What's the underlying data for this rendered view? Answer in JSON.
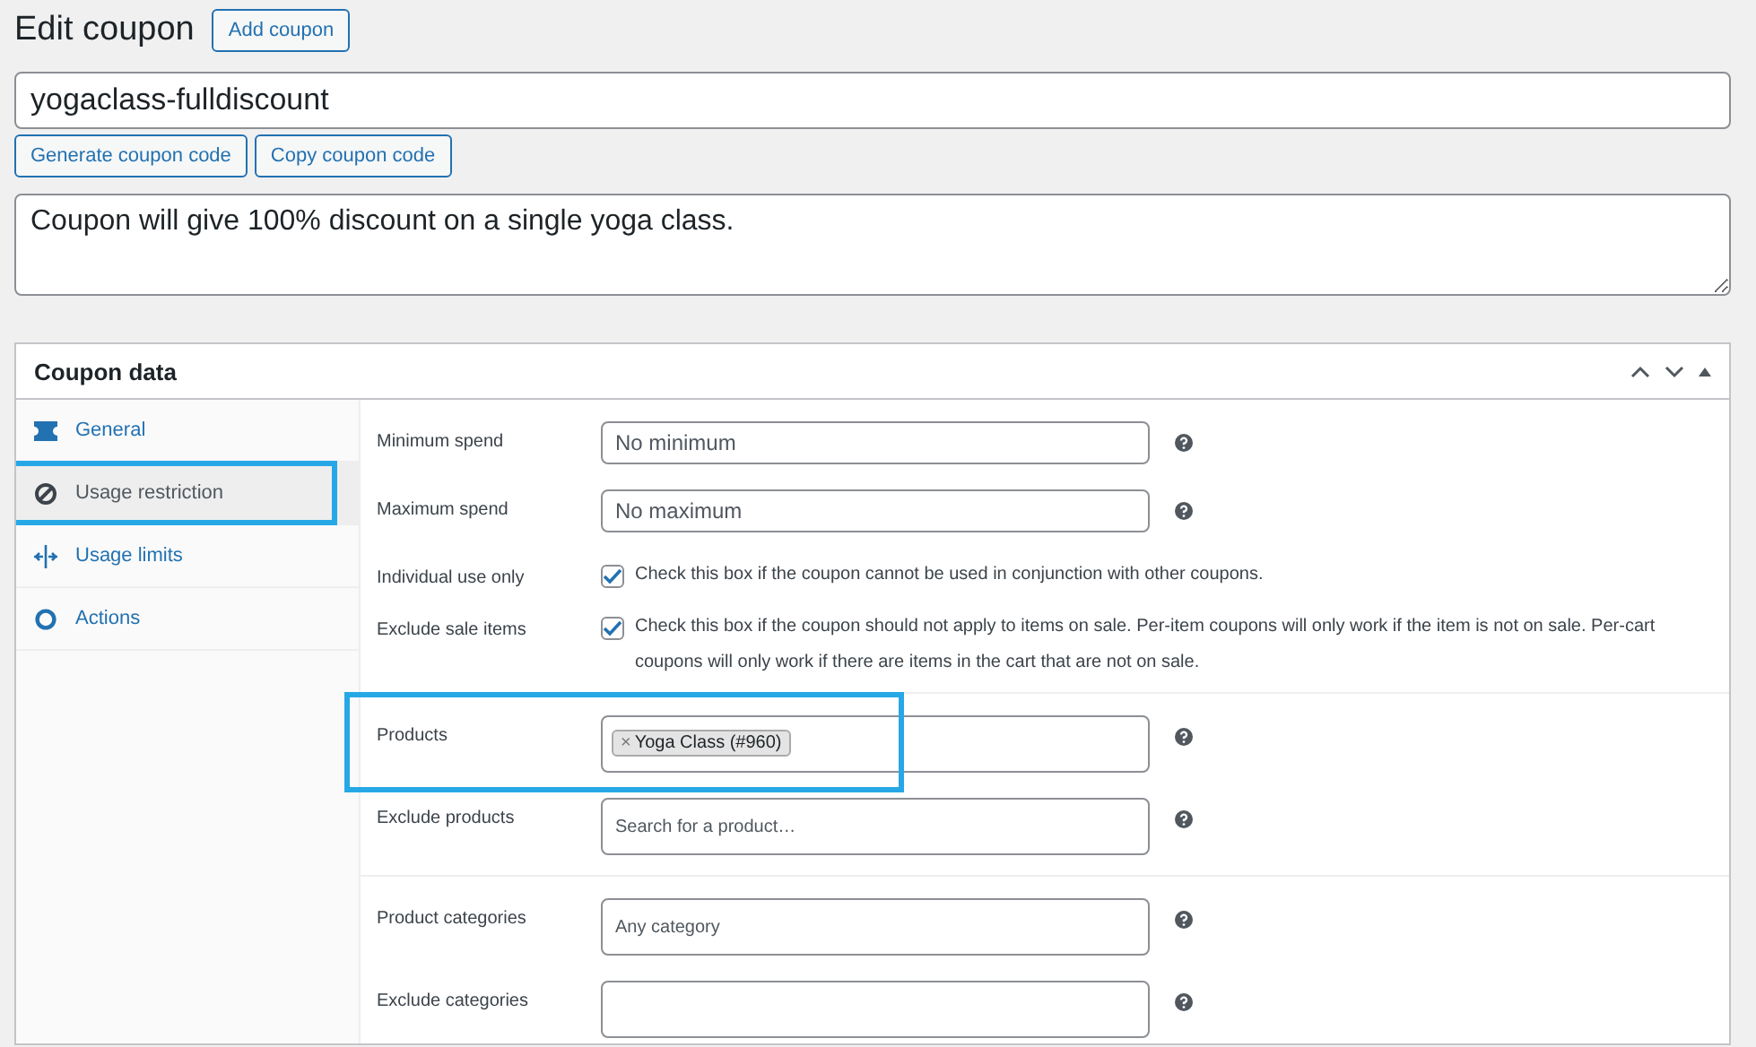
{
  "header": {
    "title": "Edit coupon",
    "add_button": "Add coupon"
  },
  "coupon_code": {
    "value": "yogaclass-fulldiscount"
  },
  "code_buttons": [
    "Generate coupon code",
    "Copy coupon code"
  ],
  "description": {
    "value": "Coupon will give 100% discount on a single yoga class."
  },
  "panel": {
    "title": "Coupon data",
    "tabs": [
      {
        "label": "General",
        "selected": false,
        "highlighted": false
      },
      {
        "label": "Usage restriction",
        "selected": true,
        "highlighted": true
      },
      {
        "label": "Usage limits",
        "selected": false,
        "highlighted": false
      },
      {
        "label": "Actions",
        "selected": false,
        "highlighted": false
      }
    ],
    "groups": [
      {
        "rows": [
          {
            "kind": "input",
            "label": "Minimum spend",
            "placeholder": "No minimum"
          },
          {
            "kind": "input",
            "label": "Maximum spend",
            "placeholder": "No maximum"
          },
          {
            "kind": "checkbox",
            "label": "Individual use only",
            "checked": true,
            "text": "Check this box if the coupon cannot be used in conjunction with other coupons."
          },
          {
            "kind": "checkbox",
            "label": "Exclude sale items",
            "checked": true,
            "text": "Check this box if the coupon should not apply to items on sale. Per-item coupons will only work if the item is not on sale. Per-cart coupons will only work if there are items in the cart that are not on sale."
          }
        ]
      },
      {
        "rows": [
          {
            "kind": "tokens",
            "label": "Products",
            "tokens": [
              {
                "remove": "×",
                "label": "Yoga Class (#960)"
              }
            ],
            "highlighted": true
          },
          {
            "kind": "input",
            "label": "Exclude products",
            "placeholder": "Search for a product…"
          }
        ]
      },
      {
        "rows": [
          {
            "kind": "input",
            "label": "Product categories",
            "placeholder": "Any category"
          },
          {
            "kind": "input",
            "label": "Exclude categories"
          }
        ]
      }
    ]
  }
}
